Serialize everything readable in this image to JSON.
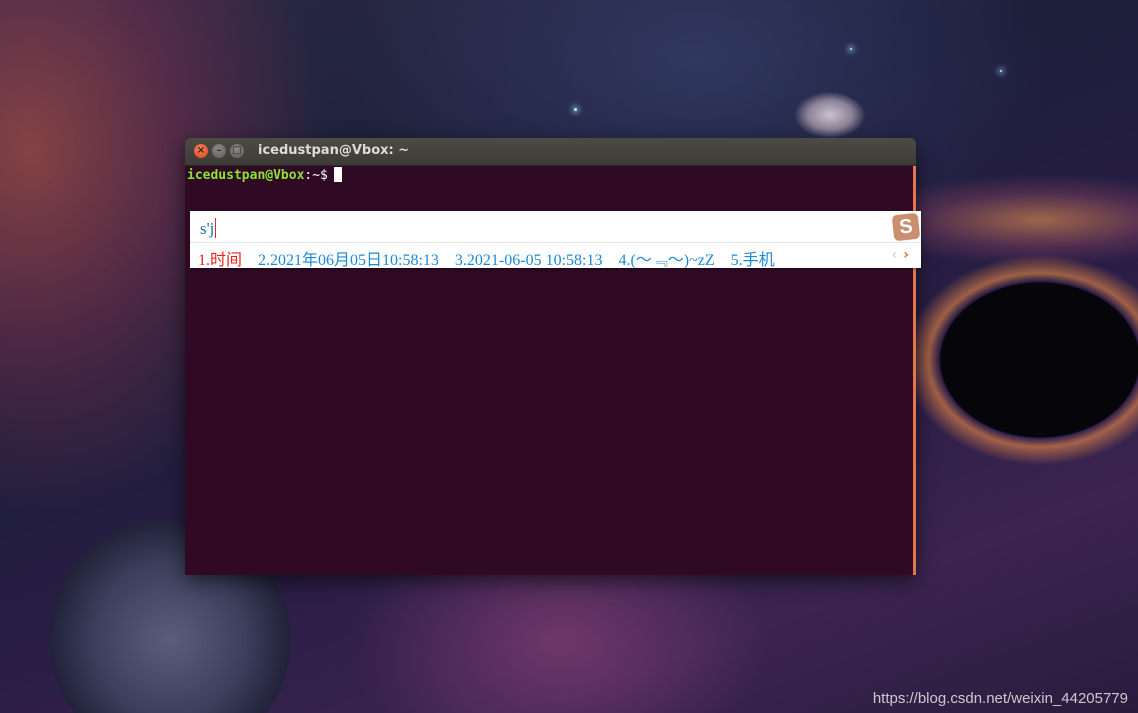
{
  "window": {
    "title": "icedustpan@Vbox: ~"
  },
  "terminal": {
    "prompt_user": "icedustpan@Vbox",
    "prompt_sep": ":",
    "prompt_path": "~$"
  },
  "ime": {
    "input": "s'j",
    "logo": "S",
    "candidates": [
      {
        "index": "1.",
        "text": "时间"
      },
      {
        "index": "2.",
        "text": "2021年06月05日10:58:13"
      },
      {
        "index": "3.",
        "text": "2021-06-05 10:58:13"
      },
      {
        "index": "4.",
        "text": "(～﹃～)~zZ"
      },
      {
        "index": "5.",
        "text": "手机"
      }
    ],
    "prev_icon": "chevron-left-icon",
    "next_icon": "chevron-right-icon"
  },
  "watermark": "https://blog.csdn.net/weixin_44205779",
  "colors": {
    "terminal_bg": "#300a24",
    "prompt_user": "#8ae234",
    "candidate_active": "#e8251a",
    "candidate": "#1b8ad6"
  }
}
